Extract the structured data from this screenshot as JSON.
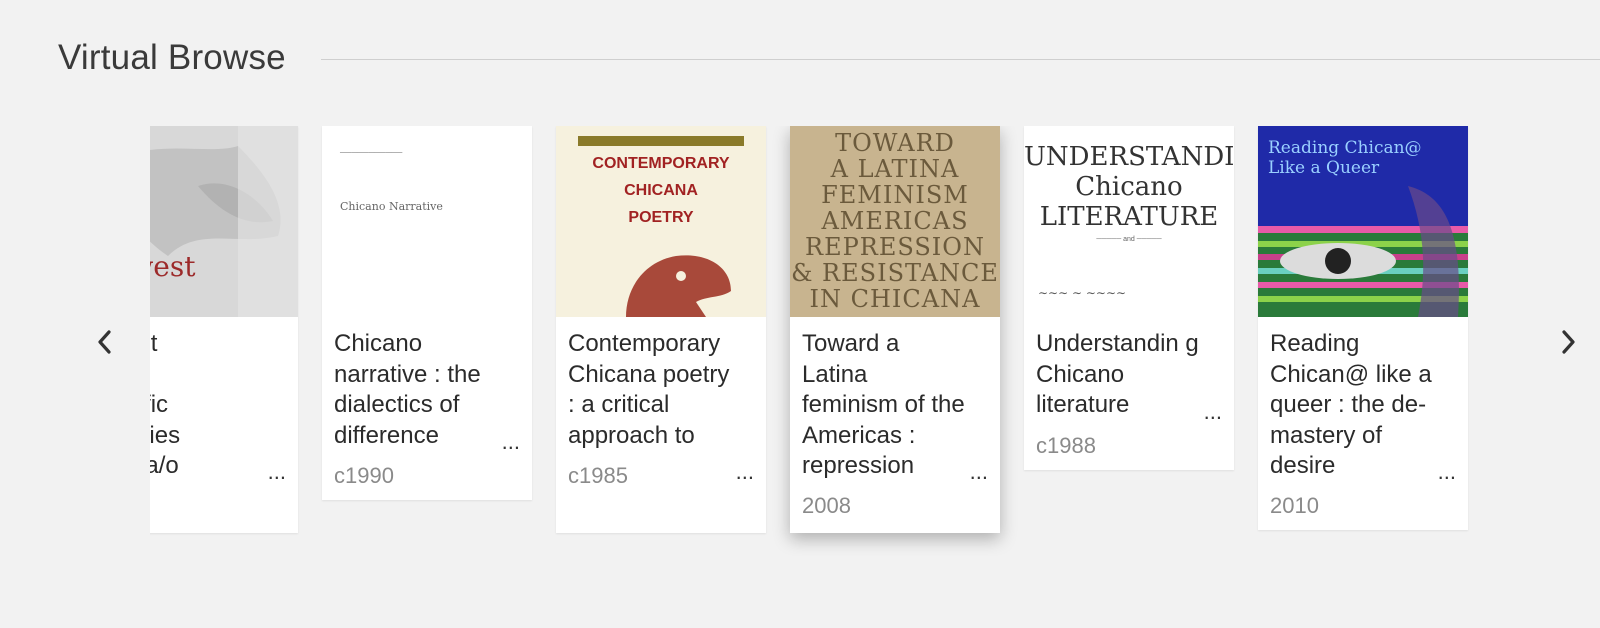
{
  "section": {
    "title": "Virtual Browse"
  },
  "nav": {
    "prev_icon": "chevron-left-icon",
    "next_icon": "chevron-right-icon"
  },
  "books": [
    {
      "title": "Southwest Asia : the transpacific geographies of Chicana/o",
      "title_visible": "thwest\n: the\nspacific\ngraphies\nhicana/o",
      "year": "",
      "cover_text": "uthwest\nAsia"
    },
    {
      "title": "Chicano narrative : the dialectics of difference",
      "title_visible": "Chicano narrative : the dialectics of difference",
      "year": "c1990",
      "cover_text": "Chicano Narrative"
    },
    {
      "title": "Contemporary Chicana poetry : a critical approach to",
      "title_visible": "Contemporary Chicana poetry : a critical approach to",
      "year": "c1985",
      "cover_text": "CONTEMPORARY\nCHICANA\nPOETRY"
    },
    {
      "title": "Toward a Latina feminism of the Americas : repression",
      "title_visible": "Toward a Latina feminism of the Americas : repression",
      "year": "2008",
      "cover_text": "TOWARD\nA LATINA\nFEMINISM\nAMERICAS\nREPRESSION\n& RESISTANCE\nIN CHICANA"
    },
    {
      "title": "Understanding Chicano literature",
      "title_visible": "Understandin g Chicano literature",
      "year": "c1988",
      "cover_text": "UNDERSTANDING\nChicano\nLITERATURE"
    },
    {
      "title": "Reading Chican@ like a queer : the de-mastery of desire",
      "title_visible": "Reading Chican@ like a queer : the de-mastery of desire",
      "year": "2010",
      "cover_text": "Reading Chican@\nLike a Queer"
    }
  ],
  "more_label": "...",
  "colors": {
    "background": "#f2f2f2",
    "card": "#ffffff",
    "year": "#8a8a8a"
  }
}
